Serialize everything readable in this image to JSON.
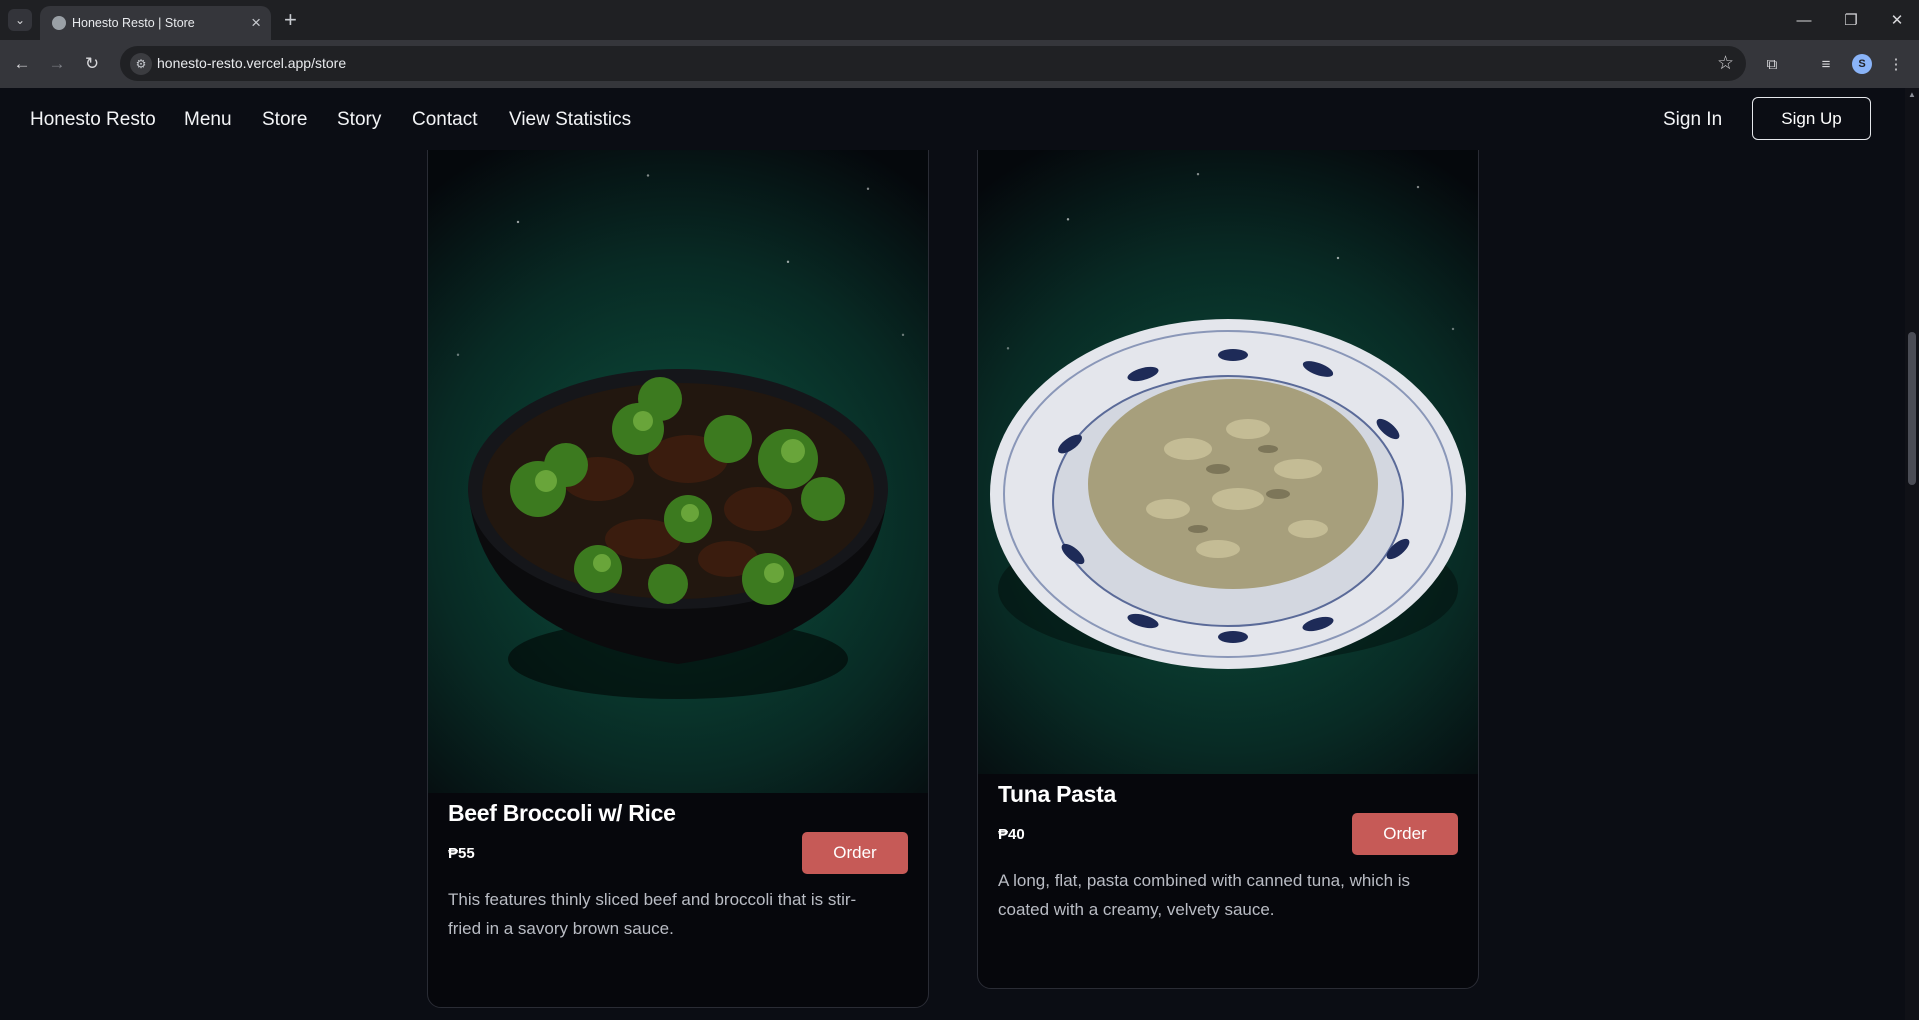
{
  "browser": {
    "tab_title": "Honesto Resto | Store",
    "url": "honesto-resto.vercel.app/store",
    "profile_initial": "S"
  },
  "nav": {
    "brand": "Honesto Resto",
    "links": [
      "Menu",
      "Store",
      "Story",
      "Contact",
      "View Statistics"
    ],
    "sign_in": "Sign In",
    "sign_up": "Sign Up"
  },
  "products": [
    {
      "name": "Beef Broccoli w/ Rice",
      "price": "₱55",
      "order_label": "Order",
      "description": "This features thinly sliced beef and broccoli that is stir-fried in a savory brown sauce."
    },
    {
      "name": "Tuna Pasta",
      "price": "₱40",
      "order_label": "Order",
      "description": "A long, flat, pasta combined with canned tuna, which is coated with a creamy, velvety sauce."
    }
  ],
  "colors": {
    "page_bg": "#0b0d14",
    "card_bg": "#06070c",
    "order_button": "#c65a57",
    "image_green": "#0d4a3a"
  },
  "icons": [
    "tab-list-icon",
    "favicon-icon",
    "close-icon",
    "plus-icon",
    "back-icon",
    "forward-icon",
    "reload-icon",
    "site-info-icon",
    "star-icon",
    "extensions-icon",
    "media-icon",
    "avatar",
    "more-icon",
    "minimize-icon",
    "restore-icon"
  ]
}
